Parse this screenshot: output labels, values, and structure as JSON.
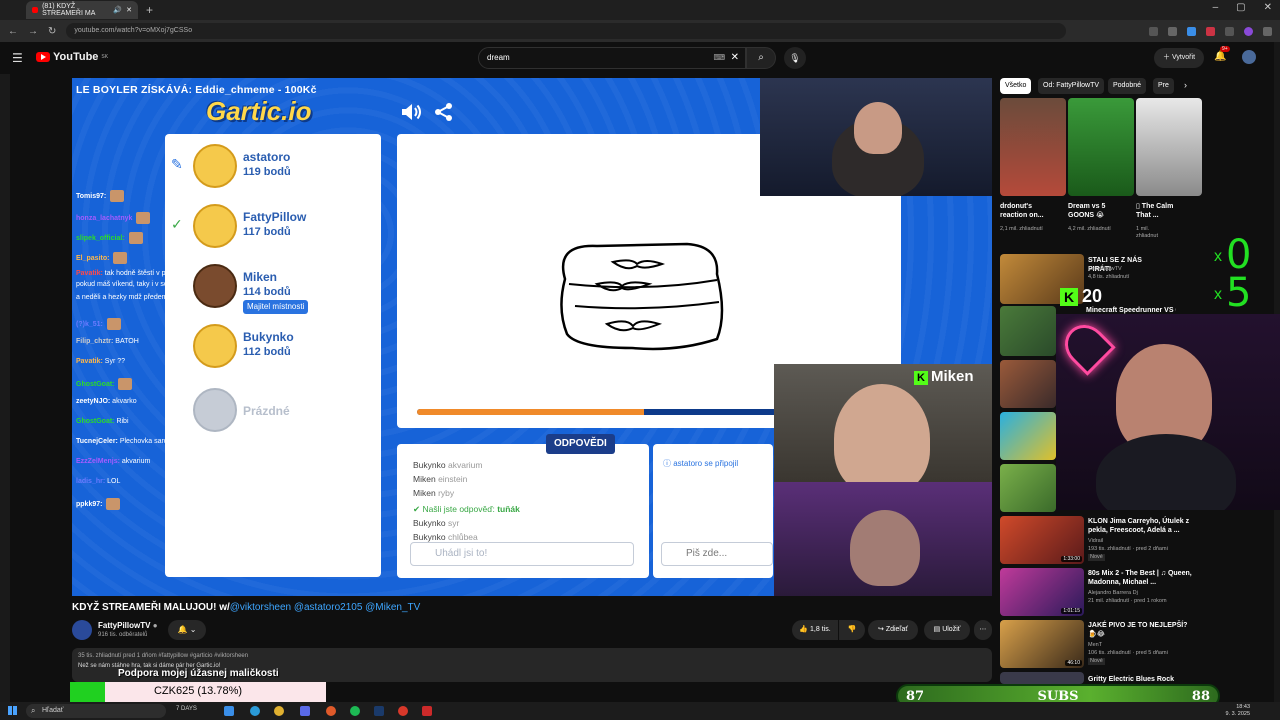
{
  "browser": {
    "tab_title": "(81) KDYŽ STREAMEŘI MA",
    "url": "youtube.com/watch?v=oMXoj7gCSSo"
  },
  "header": {
    "logo": "YouTube",
    "logo_country": "SK",
    "search_value": "dream",
    "create_label": "Vytvořit",
    "notif_count": "9+"
  },
  "stream": {
    "donation": "LE BOYLER ZÍSKÁVÁ: Eddie_chmeme - 100Kč",
    "game_logo": "Gartic.io",
    "players": [
      {
        "name": "astatoro",
        "points": "119 bodů",
        "status": "✎"
      },
      {
        "name": "FattyPillow",
        "points": "117 bodů",
        "status": "✓"
      },
      {
        "name": "Miken",
        "points": "114 bodů",
        "status": "",
        "badge": "Majitel místnosti"
      },
      {
        "name": "Bukynko",
        "points": "112 bodů",
        "status": ""
      },
      {
        "name": "Prázdné",
        "points": "",
        "status": ""
      }
    ],
    "progress": 0.63,
    "answers_title": "ODPOVĚDI",
    "answers": [
      {
        "name": "Bukynko",
        "word": "akvarium"
      },
      {
        "name": "Miken",
        "word": "einstein"
      },
      {
        "name": "Miken",
        "word": "ryby"
      },
      {
        "name": "✔ Našli jste odpověď:",
        "word": "tuňák"
      },
      {
        "name": "Bukynko",
        "word": "syr"
      },
      {
        "name": "Bukynko",
        "word": "chlůbea"
      }
    ],
    "guess_placeholder": "Uhádl jsi to!",
    "join_message": "ⓘ astatoro se připojil",
    "chat_placeholder": "Piš zde...",
    "cam_tag": "Miken",
    "chat": [
      {
        "user": "Tomis97:",
        "msg": "",
        "color": "#ffffff"
      },
      {
        "user": "honza_lachatnyk",
        "msg": "",
        "color": "#a45cff"
      },
      {
        "user": "slipek_official:",
        "msg": "",
        "color": "#2bdc2b"
      },
      {
        "user": "El_pasito:",
        "msg": "",
        "color": "#ffb84a"
      },
      {
        "user": "Pavatik:",
        "msg": "tak hodně štěstí v prvním",
        "color": "#ff4a4a"
      },
      {
        "user": "",
        "msg": "pokud máš víkend, taky i v sobotu",
        "color": "#ffffff"
      },
      {
        "user": "",
        "msg": "a neděli a hezky mdž předem",
        "color": "#ffffff"
      },
      {
        "user": "(?)k_51:",
        "msg": "",
        "color": "#6b7bff"
      },
      {
        "user": "Filip_chztr:",
        "msg": "BATOH",
        "color": "#cccccc"
      },
      {
        "user": "Pavatik:",
        "msg": "Syr ??",
        "color": "#ffb84a"
      },
      {
        "user": "GhostGoat:",
        "msg": "",
        "color": "#2bdc2b"
      },
      {
        "user": "zeetyNJO:",
        "msg": "akvarko",
        "color": "#ffffff"
      },
      {
        "user": "GhostGoat:",
        "msg": "Ribi",
        "color": "#2bdc2b"
      },
      {
        "user": "TucnejCeler:",
        "msg": "Plechovka sardinek",
        "color": "#ffffff"
      },
      {
        "user": "EzzZelMenjs:",
        "msg": "akvarium",
        "color": "#a45cff"
      },
      {
        "user": "ladis_hr:",
        "msg": "LOL",
        "color": "#6b7bff"
      },
      {
        "user": "ppkk97:",
        "msg": "",
        "color": "#ffffff"
      }
    ]
  },
  "video_meta": {
    "title": "KDYŽ STREAMEŘI MALUJOU! w/",
    "title_tags": "@viktorsheen @astatoro2105 @Miken_TV",
    "channel": "FattyPillowTV",
    "subscribers": "916 tis. odběratelů",
    "likes": "1,8 tis.",
    "share": "Zdieľať",
    "save": "Uložiť",
    "desc_stats": "35 tis. zhliadnutí  pred 1 dňom",
    "desc_tags": "#fattypillow #garticio #viktorsheen",
    "desc_text": "Než se nám stáhne hra, tak si dáme pár her Gartic.io!"
  },
  "overlays": {
    "support_text": "Podpora mojej úžasnej maličkosti",
    "goal_text": "CZK625 (13.78%)",
    "goal_fraction": 0.1378,
    "subs_left": "87",
    "subs_label": "SUBS",
    "subs_right": "88",
    "counter_top": "0",
    "counter_bottom": "5",
    "counter_x": "x",
    "kick_count": "20"
  },
  "sidebar": {
    "chips": [
      "Všetko",
      "Od: FattyPillowTV",
      "Podobné",
      "Pre"
    ],
    "shorts": [
      {
        "title": "drdonut's reaction on...",
        "views": "2,1 mil. zhliadnutí"
      },
      {
        "title": "Dream vs 5 GOONS 😭",
        "views": "4,2 mil. zhliadnutí"
      },
      {
        "title": "▯ The Calm That ...",
        "views": "1 mil. zhliadnutí"
      }
    ],
    "videos": [
      {
        "title": "STALI SE Z NÁS PIRÁTI",
        "channel": "FattyPillowTV",
        "meta": "4,8 tis. zhliadnutí"
      },
      {
        "title": "Minecraft Speedrunner VS 6",
        "channel": "",
        "meta": ""
      },
      {
        "title": "KLON Jima Carreyho, Útulek z pekla, Freescoot, Adelá a ...",
        "channel": "Vidrail",
        "meta": "193 tis. zhliadnutí · pred 2 dňami",
        "badge": "Nové",
        "duration": "1:33:00"
      },
      {
        "title": "80s Mix 2 - The Best | ♫ Queen, Madonna, Michael ...",
        "channel": "Alejandro Barrera Dj",
        "meta": "21 mil. zhliadnutí · pred 1 rokom",
        "duration": "1:01:15"
      },
      {
        "title": "JAKÉ PIVO JE TO NEJLEPŠÍ? 🍺😂",
        "channel": "MenT",
        "meta": "106 tis. zhliadnutí · pred 5 dňami",
        "badge": "Nové",
        "duration": "46:10"
      },
      {
        "title": "Gritty Electric Blues Rock",
        "channel": "",
        "meta": ""
      }
    ]
  },
  "taskbar": {
    "search_placeholder": "Hľadať",
    "time": "18:43",
    "date": "9. 3. 2025",
    "weather": "7 DAYS"
  }
}
